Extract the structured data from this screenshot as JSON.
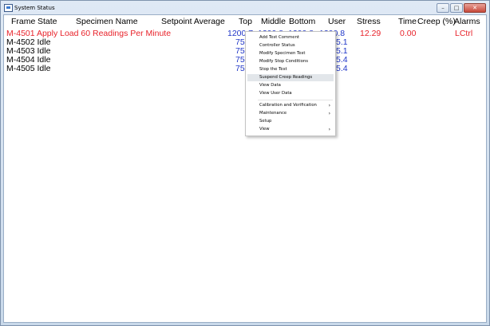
{
  "window": {
    "title": "System Status",
    "minimize_glyph": "–",
    "maximize_glyph": "□",
    "close_glyph": "✕"
  },
  "columns": {
    "frame": "Frame",
    "state": "State",
    "specimen": "Specimen Name",
    "setpoint": "Setpoint Average",
    "top": "Top",
    "middle": "Middle",
    "bottom": "Bottom",
    "user": "User",
    "stress": "Stress",
    "time": "Time",
    "creep": "Creep (%)",
    "alarms": "Alarms"
  },
  "rows": [
    {
      "frame_state": "M-4501 Apply Load 60 Readings Per Minute",
      "top": "1200.7",
      "middle": "1200.8",
      "bottom": "1200.8",
      "user": "1200.8",
      "stress": "12.29",
      "creep": "0.00",
      "alarms": "LCtrl"
    },
    {
      "frame_state": "M-4502 Idle",
      "top": "75.",
      "user": "5.1"
    },
    {
      "frame_state": "M-4503 Idle",
      "top": "75.",
      "user": "5.1"
    },
    {
      "frame_state": "M-4504 Idle",
      "top": "75.",
      "user": "5.4"
    },
    {
      "frame_state": "M-4505 Idle",
      "top": "75.",
      "user": "5.4"
    }
  ],
  "context_menu": {
    "items": [
      {
        "label": "Add Test Comment"
      },
      {
        "label": "Controller Status"
      },
      {
        "label": "Modify Specimen Test"
      },
      {
        "label": "Modify Stop Conditions"
      },
      {
        "label": "Stop the Test"
      },
      {
        "label": "Suspend Creep Readings",
        "highlighted": true
      },
      {
        "label": "View Data"
      },
      {
        "label": "View User Data"
      },
      {
        "label": "Calibration and Verification",
        "submenu": true
      },
      {
        "label": "Maintenance",
        "submenu": true
      },
      {
        "label": "Setup"
      },
      {
        "label": "View",
        "submenu": true
      }
    ],
    "submenu_glyph": "›"
  },
  "colors": {
    "active_row": "#e8222a",
    "readings": "#2036c8",
    "idle_row": "#000000",
    "menu_highlight": "#e2e6ea"
  }
}
